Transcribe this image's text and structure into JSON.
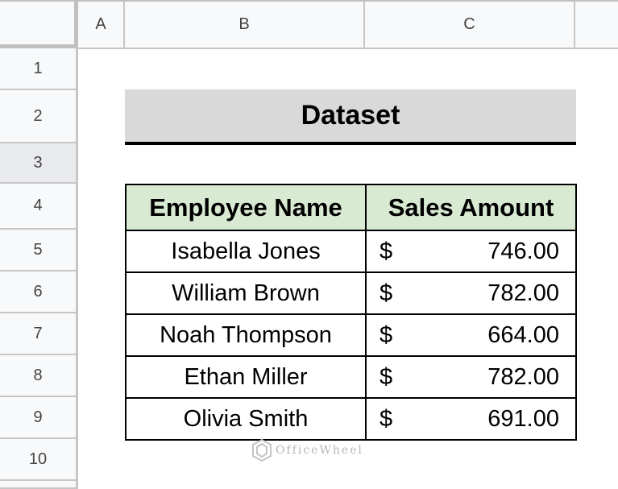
{
  "sheet": {
    "columns": [
      "A",
      "B",
      "C",
      ""
    ],
    "rows": [
      "1",
      "2",
      "3",
      "4",
      "5",
      "6",
      "7",
      "8",
      "9",
      "10"
    ],
    "selected_row": "3"
  },
  "title": "Dataset",
  "table": {
    "headers": [
      "Employee Name",
      "Sales Amount"
    ],
    "rows": [
      {
        "name": "Isabella Jones",
        "currency": "$",
        "amount": "746.00"
      },
      {
        "name": "William Brown",
        "currency": "$",
        "amount": "782.00"
      },
      {
        "name": "Noah Thompson",
        "currency": "$",
        "amount": "664.00"
      },
      {
        "name": "Ethan Miller",
        "currency": "$",
        "amount": "782.00"
      },
      {
        "name": "Olivia Smith",
        "currency": "$",
        "amount": "691.00"
      }
    ]
  },
  "watermark": "OfficeWheel",
  "colors": {
    "title_bg": "#d9d9d9",
    "header_bg": "#d9ead3",
    "selected_row_bg": "#e8eaed"
  }
}
